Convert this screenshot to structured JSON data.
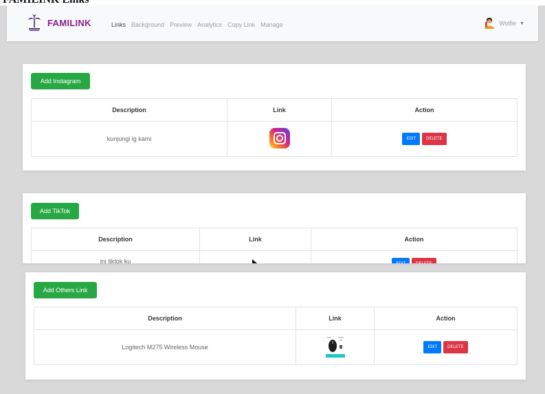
{
  "header_strip": {
    "text": "FAMILINK Links"
  },
  "navbar": {
    "brand": "FAMILINK",
    "links": [
      "Links",
      "Background",
      "Preview",
      "Analytics",
      "Copy Link",
      "Manage"
    ],
    "active": "Links",
    "user": "Wolfie"
  },
  "instagram": {
    "add_label": "Add Instagram",
    "columns": [
      "Description",
      "Link",
      "Action"
    ],
    "rows": [
      {
        "description": "kunjungi ig kami",
        "link_icon": "instagram-icon"
      }
    ]
  },
  "tiktok": {
    "add_label": "Add TikTok",
    "columns": [
      "Description",
      "Link",
      "Action"
    ],
    "rows": [
      {
        "description": "ini tiktok ku",
        "link_icon": "tiktok-icon"
      }
    ]
  },
  "others": {
    "add_label": "Add Others Link",
    "columns": [
      "Description",
      "Link",
      "Action"
    ],
    "rows": [
      {
        "description": "Logitech M275 Wireless Mouse",
        "link_icon": "product-thumbnail"
      }
    ]
  },
  "actions": {
    "edit": "EDIT",
    "delete": "DELETE"
  },
  "colors": {
    "brand": "#8a1f8f",
    "add": "#28a745",
    "edit": "#007bff",
    "delete": "#dc3545"
  }
}
